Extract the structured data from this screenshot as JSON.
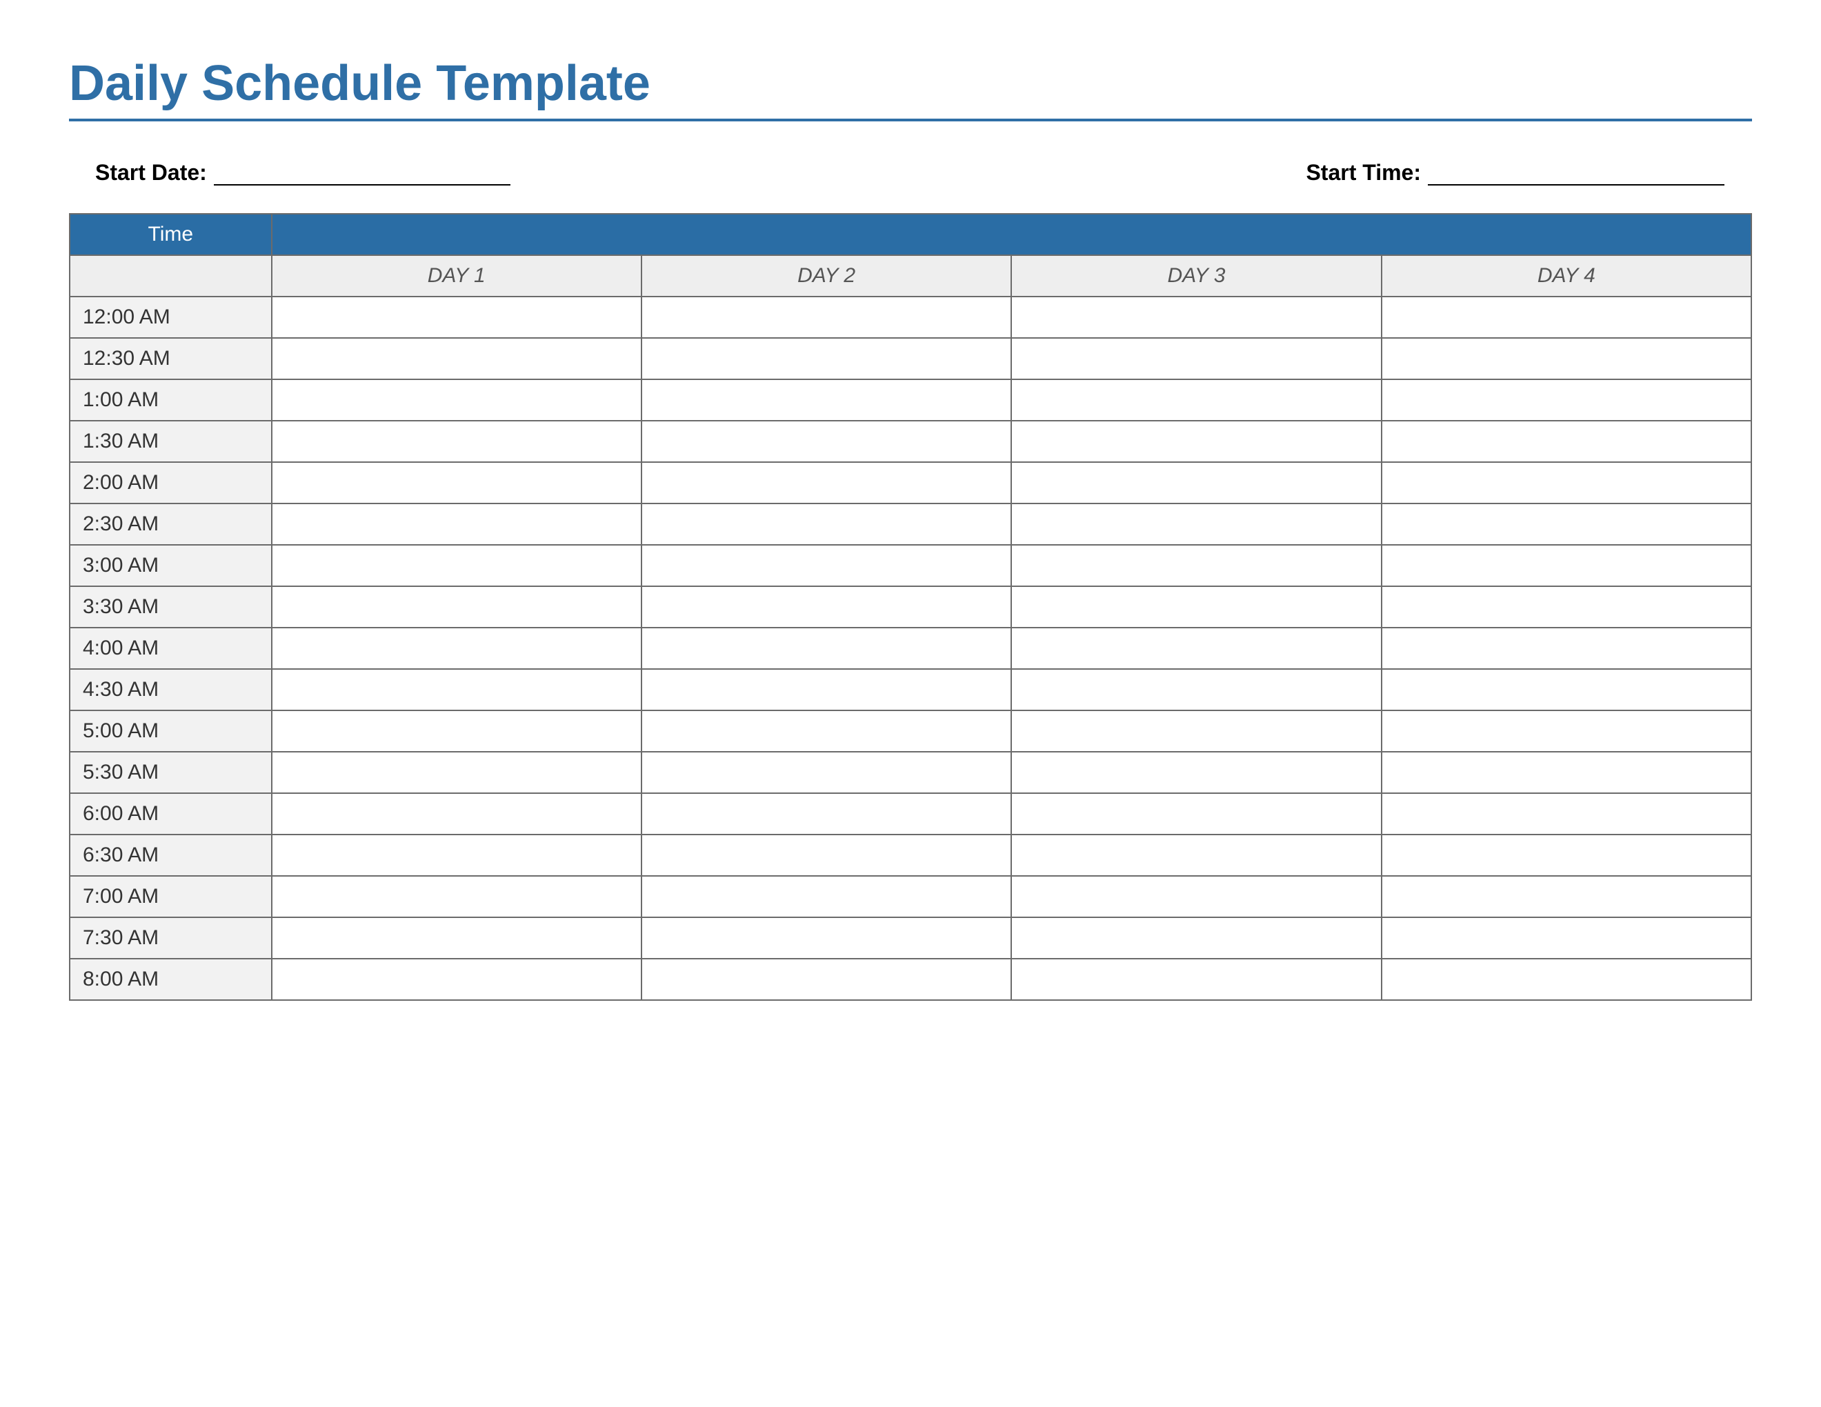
{
  "title": "Daily Schedule Template",
  "meta": {
    "start_date_label": "Start Date:",
    "start_date_value": "",
    "start_time_label": "Start Time:",
    "start_time_value": ""
  },
  "table": {
    "time_header": "Time",
    "days": [
      "DAY 1",
      "DAY 2",
      "DAY 3",
      "DAY 4"
    ],
    "times": [
      "12:00 AM",
      "12:30 AM",
      "1:00 AM",
      "1:30 AM",
      "2:00 AM",
      "2:30 AM",
      "3:00 AM",
      "3:30 AM",
      "4:00 AM",
      "4:30 AM",
      "5:00 AM",
      "5:30 AM",
      "6:00 AM",
      "6:30 AM",
      "7:00 AM",
      "7:30 AM",
      "8:00 AM"
    ]
  },
  "colors": {
    "accent": "#2f6fa6",
    "header": "#2a6da5",
    "light_fill": "#eeeeee",
    "time_fill": "#f2f2f2",
    "border": "#6b6b6b"
  }
}
